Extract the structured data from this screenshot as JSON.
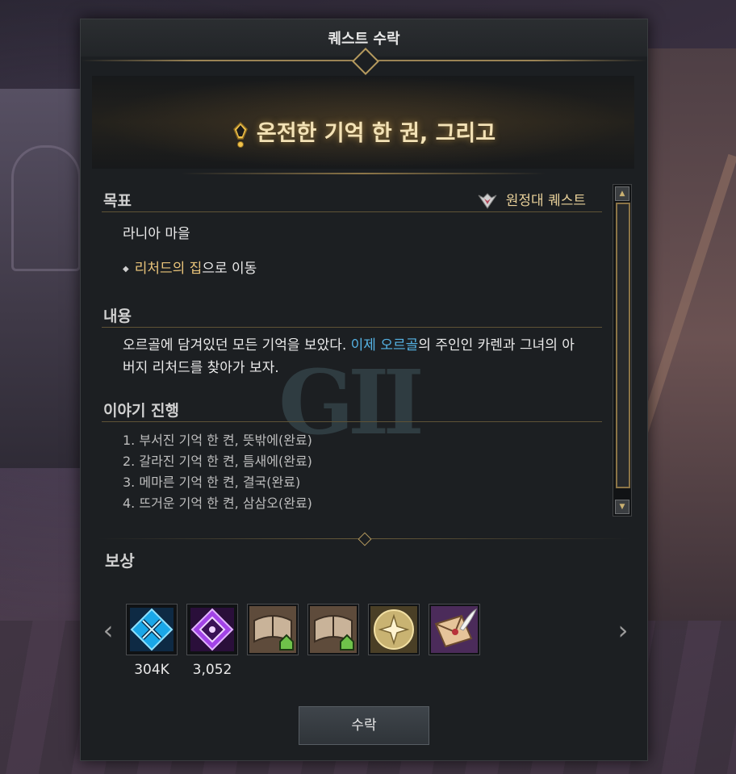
{
  "window": {
    "title": "퀘스트 수락"
  },
  "quest": {
    "name": "온전한 기억 한 권, 그리고",
    "type_label": "원정대 퀘스트"
  },
  "sections": {
    "objective": {
      "heading": "목표",
      "location": "라니아 마을",
      "task_highlight": "리처드의 집",
      "task_rest": "으로 이동"
    },
    "content": {
      "heading": "내용",
      "text_1": "오르골에 담겨있던 모든 기억을 보았다. ",
      "text_2": "이제 오르골",
      "text_3": "의 주인인 카렌과 그녀의 아버지 리처드를 찾아가 보자."
    },
    "story": {
      "heading": "이야기 진행",
      "items": [
        "1. 부서진 기억 한 켠, 뜻밖에(완료)",
        "2. 갈라진 기억 한 켠, 틈새에(완료)",
        "3. 메마른 기억 한 켠, 결국(완료)",
        "4. 뜨거운 기억 한 켠, 삼삼오(완료)"
      ]
    }
  },
  "rewards": {
    "heading": "보상",
    "items": [
      {
        "icon": "blue-crossed-tools-icon",
        "qty": "304K",
        "color": "#1aa7e8"
      },
      {
        "icon": "purple-crystal-icon",
        "qty": "3,052",
        "color": "#a243e6"
      },
      {
        "icon": "book-house-icon",
        "qty": "",
        "color": "#9a8064"
      },
      {
        "icon": "book-house-icon",
        "qty": "",
        "color": "#9a8064"
      },
      {
        "icon": "gold-emblem-icon",
        "qty": "",
        "color": "#c9b372"
      },
      {
        "icon": "letter-feather-icon",
        "qty": "",
        "color": "#7a4b8c"
      }
    ]
  },
  "buttons": {
    "accept": "수락"
  },
  "watermark": "GII"
}
